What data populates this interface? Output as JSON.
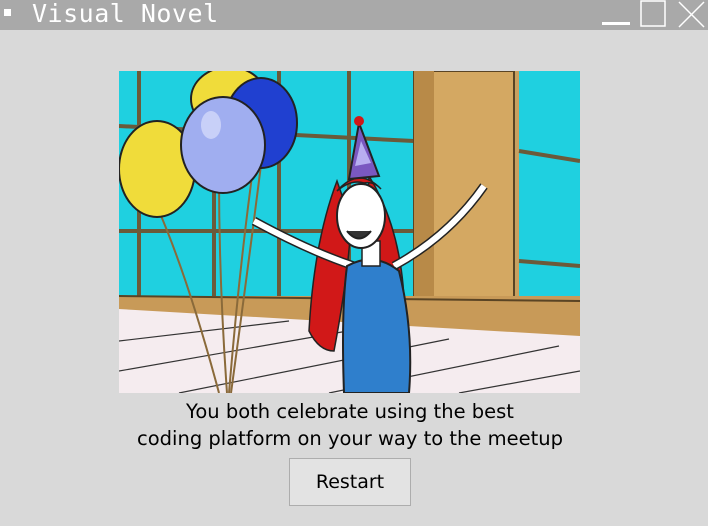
{
  "window": {
    "title": "Visual Novel",
    "controls": [
      "minimize-icon",
      "maximize-icon",
      "close-icon"
    ]
  },
  "scene": {
    "image": "party-celebration-illustration"
  },
  "dialogue": {
    "line1": "You both celebrate using the best",
    "line2": "coding platform on your way to the meetup"
  },
  "actions": {
    "restart_label": "Restart"
  }
}
